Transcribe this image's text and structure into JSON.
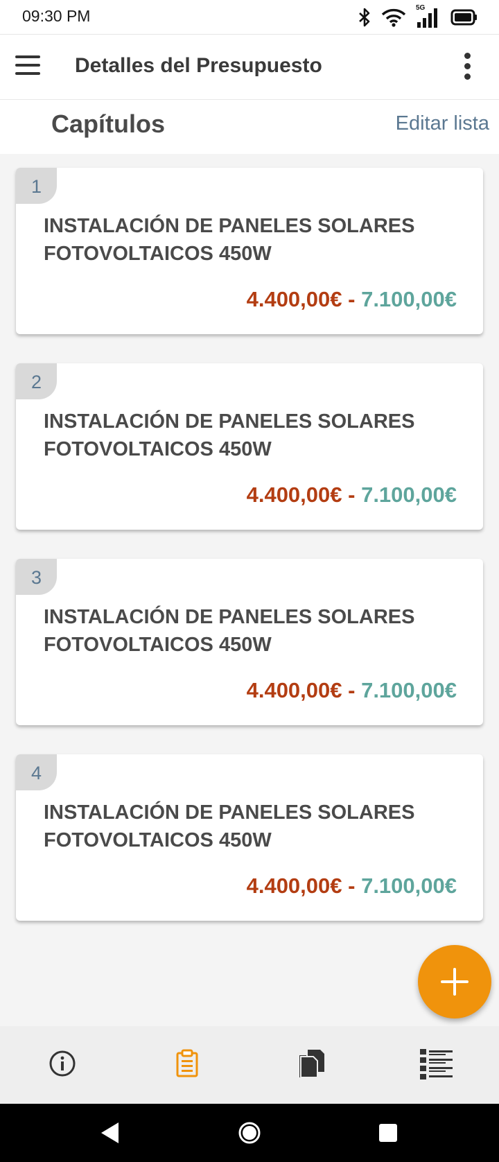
{
  "status_bar": {
    "time": "09:30 PM",
    "network": "5G"
  },
  "app_bar": {
    "title": "Detalles del Presupuesto"
  },
  "section": {
    "title": "Capítulos",
    "edit_label": "Editar lista"
  },
  "chapters": [
    {
      "number": "1",
      "title": "INSTALACIÓN DE PANELES SOLARES FOTOVOLTAICOS 450W",
      "price_min": "4.400,00€",
      "separator": " - ",
      "price_max": "7.100,00€"
    },
    {
      "number": "2",
      "title": "INSTALACIÓN DE PANELES SOLARES FOTOVOLTAICOS 450W",
      "price_min": "4.400,00€",
      "separator": " - ",
      "price_max": "7.100,00€"
    },
    {
      "number": "3",
      "title": "INSTALACIÓN DE PANELES SOLARES FOTOVOLTAICOS 450W",
      "price_min": "4.400,00€",
      "separator": " - ",
      "price_max": "7.100,00€"
    },
    {
      "number": "4",
      "title": "INSTALACIÓN DE PANELES SOLARES FOTOVOLTAICOS 450W",
      "price_min": "4.400,00€",
      "separator": " - ",
      "price_max": "7.100,00€"
    }
  ],
  "bottom_nav": {
    "items": [
      {
        "icon": "info-icon",
        "active": false
      },
      {
        "icon": "clipboard-icon",
        "active": true
      },
      {
        "icon": "documents-icon",
        "active": false
      },
      {
        "icon": "checklist-icon",
        "active": false
      }
    ]
  },
  "colors": {
    "accent": "#f0930c",
    "price_min": "#b33d12",
    "price_max": "#5ea59c",
    "link": "#5b7891",
    "nav_inactive": "#333333"
  }
}
